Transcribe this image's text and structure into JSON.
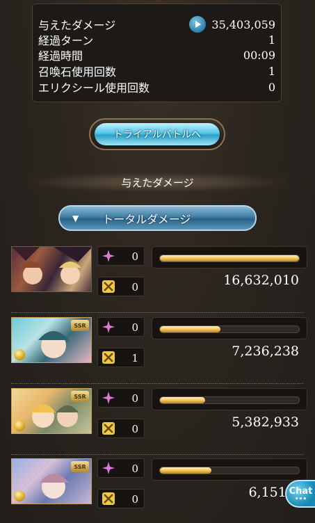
{
  "stats": [
    {
      "label": "与えたダメージ",
      "value": "35,403,059",
      "icon": "play-icon"
    },
    {
      "label": "経過ターン",
      "value": "1"
    },
    {
      "label": "経過時間",
      "value": "00:09"
    },
    {
      "label": "召喚石使用回数",
      "value": "1"
    },
    {
      "label": "エリクシール使用回数",
      "value": "0"
    }
  ],
  "trial_button": "トライアルバトルへ",
  "section_title": "与えたダメージ",
  "damage_select": {
    "label": "トータルダメージ",
    "arrow": "▼"
  },
  "characters": [
    {
      "name": "char-1",
      "rarity": "",
      "star_count": "0",
      "skill_count": "0",
      "damage": "16,632,010",
      "damage_fraction": 1.0
    },
    {
      "name": "char-2",
      "rarity": "SSR",
      "star_count": "0",
      "skill_count": "1",
      "damage": "7,236,238",
      "damage_fraction": 0.435
    },
    {
      "name": "char-3",
      "rarity": "SSR",
      "star_count": "0",
      "skill_count": "0",
      "damage": "5,382,933",
      "damage_fraction": 0.324
    },
    {
      "name": "char-4",
      "rarity": "SSR",
      "star_count": "0",
      "skill_count": "0",
      "damage": "6,151,8",
      "damage_fraction": 0.37
    }
  ],
  "chat": {
    "label": "Chat",
    "dots": "•••"
  },
  "colors": {
    "accent_blue": "#2d9fc6",
    "bar_gold": "#f2c45a",
    "star_pink": "#e07ad8",
    "panel_bg": "#1c1916"
  }
}
